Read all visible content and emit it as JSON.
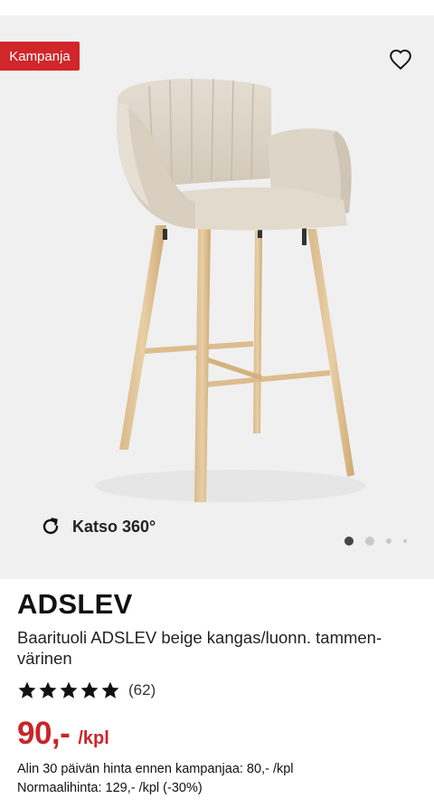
{
  "product": {
    "badge": "Kampanja",
    "view360_label": "Katso 360°",
    "carousel_count": 4,
    "carousel_active": 0,
    "title": "ADSLEV",
    "description": "Baarituoli ADSLEV beige kangas/luonn. tammen-värinen",
    "rating_stars": 5,
    "rating_count": "(62)",
    "price_amount": "90,-",
    "price_unit": "/kpl",
    "lowest_price_note": "Alin 30 päivän hinta ennen kampanjaa: 80,- /kpl",
    "normal_price_note": "Normaalihinta: 129,- /kpl (-30%)"
  },
  "icons": {
    "favorite": "heart-icon",
    "rotate": "rotate-360-icon",
    "star": "star-icon"
  },
  "colors": {
    "badge_bg": "#d1262a",
    "price": "#c8252b",
    "hero_bg": "#f0f0f0"
  }
}
